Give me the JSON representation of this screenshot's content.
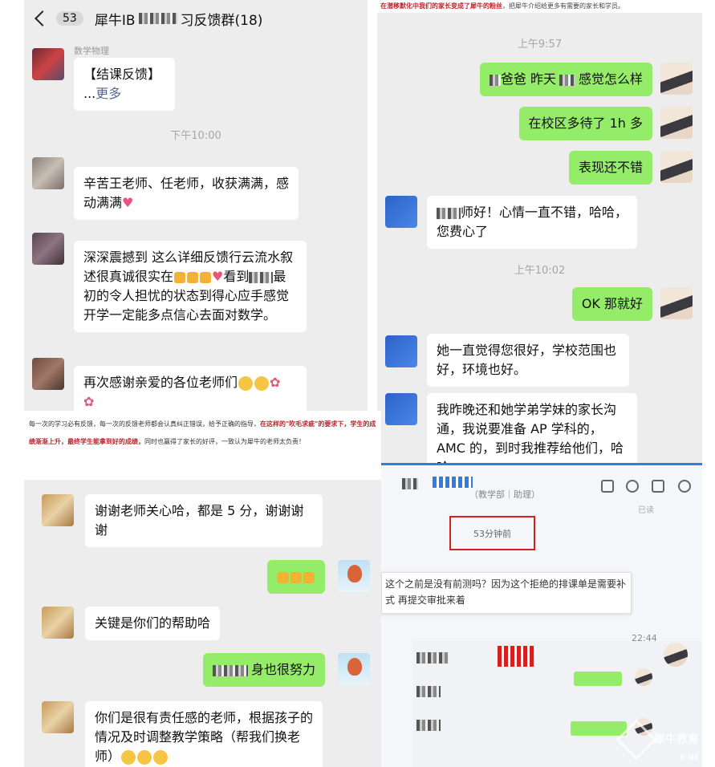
{
  "panel1": {
    "title": "犀牛IB",
    "title_suffix": "习反馈群(18)",
    "unread_count": "53",
    "sender1": "数学物理",
    "msg1_line1": "【结课反馈】",
    "msg1_more_prefix": "...",
    "msg1_more": "更多",
    "time1": "下午10:00",
    "msg2": "辛苦王老师、任老师，收获满满，感动满满",
    "msg3_a": "深深震撼到 这么详细反馈行云流水叙述很真诚很实在",
    "msg3_b": "看到",
    "msg3_c": "最初的令人担忧的状态到得心应手感觉开学一定能多点信心去面对数学。",
    "msg4": "再次感谢亲爱的各位老师们"
  },
  "panel2": {
    "caption_red": "在潜移默化中我们的家长变成了犀牛的粉丝",
    "caption_rest": "，把犀牛介绍给更多有需要的家长和学员。",
    "time1": "上午9:57",
    "msg1": "爸爸 昨天",
    "msg1b": "感觉怎么样",
    "msg2": "在校区多待了 1h 多",
    "msg3": "表现还不错",
    "msg4_a": "师好！心情一直不错，哈哈，",
    "msg4_b": "您费心了",
    "time2": "上午10:02",
    "msg5": "OK 那就好",
    "msg6": "她一直觉得您很好，学校范围也好，环境也好。",
    "msg7": "我昨晚还和她学弟学妹的家长沟通，我说要准备 AP 学科的，AMC 的，到时我推荐给他们，哈哈"
  },
  "panel3": {
    "caption_a": "每一次的学习必有反馈，每一次的反馈老师都会认真纠正错误，给予正确的指导，",
    "caption_red1": "在这样的\"吹毛求疵\"的要求下，",
    "caption_red2": "学生的成绩渐渐上升，最终学生能拿到好的成绩，",
    "caption_b": "同时也赢得了家长的好评，一致认为犀牛的老师太负责！",
    "msg1": "谢谢老师关心哈，都是 5 分，谢谢谢谢",
    "msg3": "关键是你们的帮助哈",
    "msg4": "身也很努力",
    "msg5": "你们是很有责任感的老师，根据孩子的情况及时调整教学策略（帮我们换老师）"
  },
  "panel4": {
    "subtitle": "（教学部｜助理）",
    "read_status": "已读",
    "boxed_time": "53分钟前",
    "msg_line1": "这个之前是没有前测吗？因为这个拒绝的排课单是需要补",
    "msg_line2": "式 再提交审批来着",
    "time": "22:44",
    "watermark": "犀牛教育",
    "watermark_sub": "X·NE"
  }
}
